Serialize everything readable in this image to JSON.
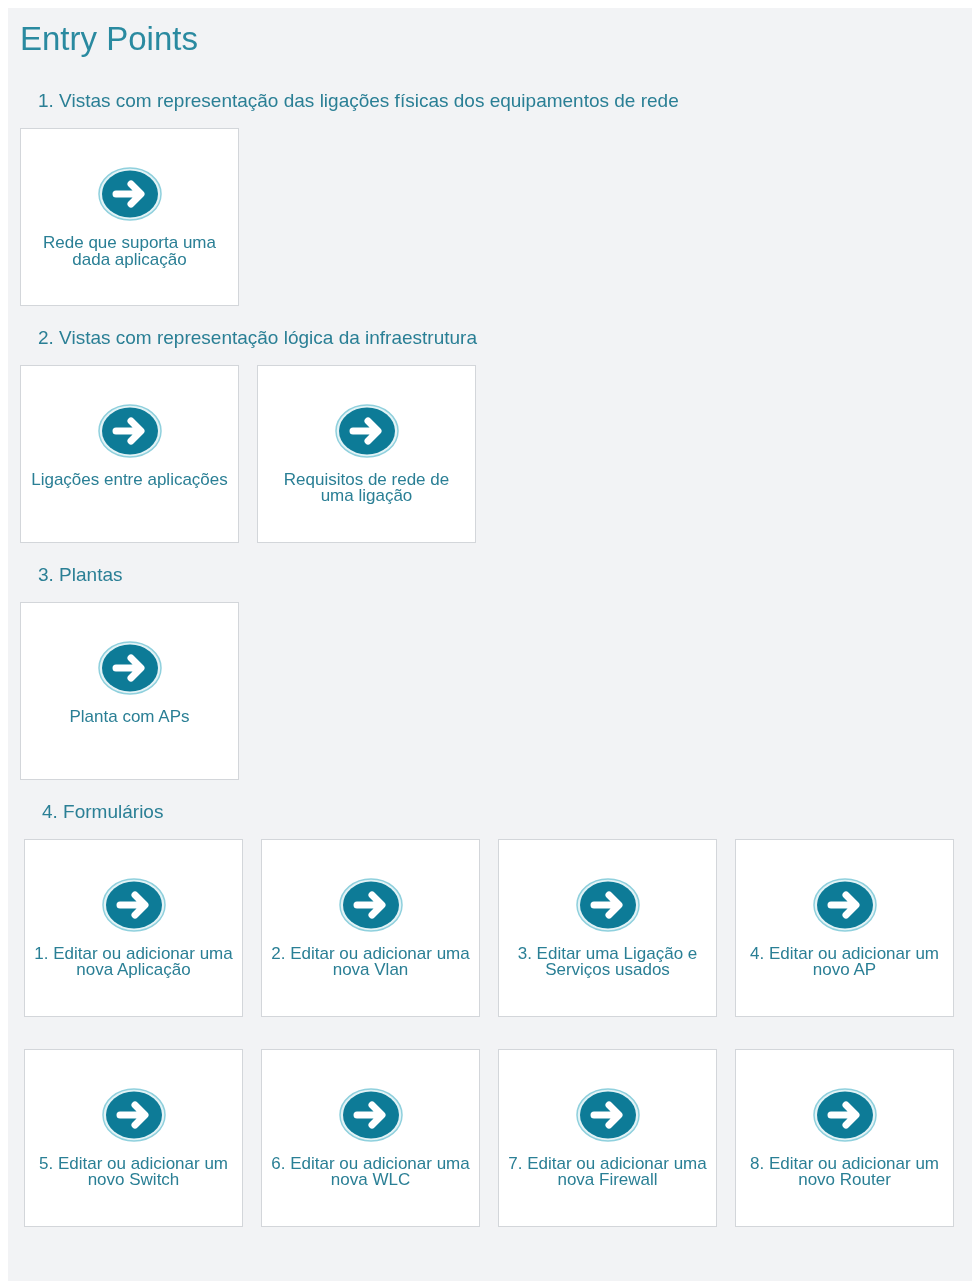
{
  "title": "Entry Points",
  "sections": [
    {
      "heading": "1. Vistas com representação das ligações físicas dos equipamentos de rede",
      "cards": [
        {
          "label": "Rede que suporta uma dada aplicação"
        }
      ]
    },
    {
      "heading": "2. Vistas com representação lógica da infraestrutura",
      "cards": [
        {
          "label": "Ligações entre aplicações"
        },
        {
          "label": "Requisitos de rede de uma ligação"
        }
      ]
    },
    {
      "heading": "3. Plantas",
      "cards": [
        {
          "label": "Planta com APs"
        }
      ]
    },
    {
      "heading": "4. Formulários",
      "cards": [
        {
          "label": "1. Editar ou adicionar uma nova Aplicação"
        },
        {
          "label": "2. Editar ou adicionar uma nova Vlan"
        },
        {
          "label": "3. Editar uma Ligação e Serviços usados"
        },
        {
          "label": "4. Editar ou adicionar um novo AP"
        },
        {
          "label": "5. Editar ou adicionar um novo Switch"
        },
        {
          "label": "6. Editar ou adicionar uma nova WLC"
        },
        {
          "label": "7. Editar ou adicionar uma nova Firewall"
        },
        {
          "label": "8. Editar ou adicionar um novo Router"
        }
      ]
    }
  ]
}
